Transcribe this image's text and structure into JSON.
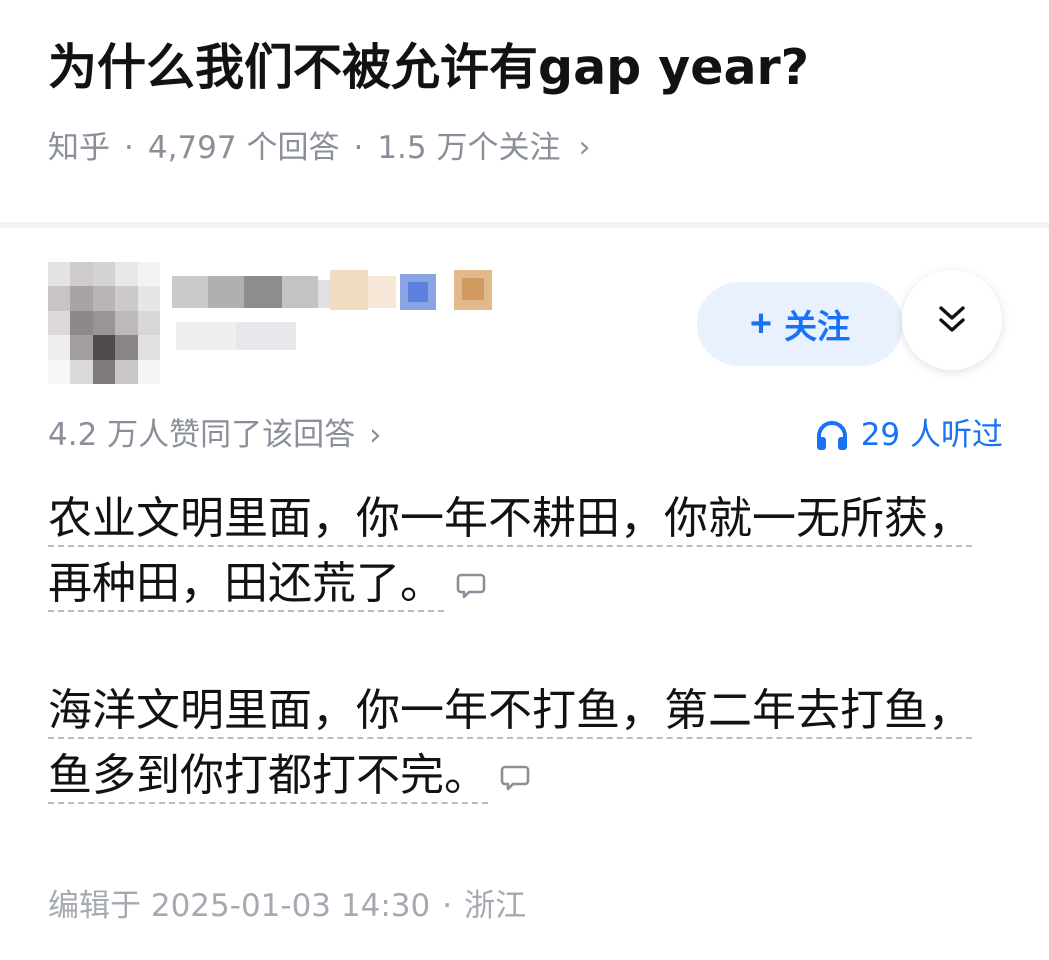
{
  "question": {
    "title": "为什么我们不被允许有gap year?",
    "source": "知乎",
    "answer_count": "4,797 个回答",
    "follower_count": "1.5 万个关注",
    "separator": "·",
    "chevron": "›"
  },
  "author": {
    "name_obscured": true,
    "follow_label": "关注",
    "follow_plus": "+"
  },
  "stats": {
    "upvote_text": "4.2 万人赞同了该回答",
    "chevron": "›",
    "listen_text": "29 人听过"
  },
  "answer": {
    "paragraphs": [
      "农业文明里面，你一年不耕田，你就一无所获，再种田，田还荒了。",
      "海洋文明里面，你一年不打鱼，第二年去打鱼，鱼多到你打都打不完。"
    ]
  },
  "footer": {
    "edit_prefix": "编辑于",
    "edit_time": "2025-01-03 14:30",
    "separator": "·",
    "location": "浙江"
  },
  "colors": {
    "accent": "#1772f6",
    "follow_bg": "#eaf1fe",
    "meta_gray": "#8a8f99",
    "text": "#121212"
  },
  "icons": {
    "more": "chevron-double-down-icon",
    "listen": "headphones-icon",
    "comment": "comment-bubble-icon"
  }
}
